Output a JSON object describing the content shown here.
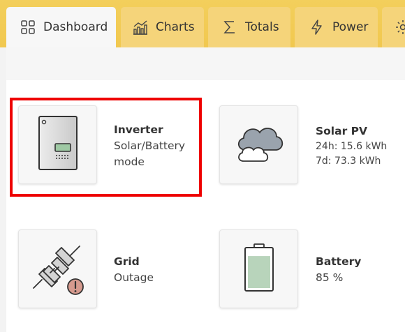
{
  "tabs": [
    {
      "label": "Dashboard",
      "icon": "grid-icon",
      "active": true
    },
    {
      "label": "Charts",
      "icon": "bar-chart-icon",
      "active": false
    },
    {
      "label": "Totals",
      "icon": "sigma-icon",
      "active": false
    },
    {
      "label": "Power",
      "icon": "lightning-icon",
      "active": false
    },
    {
      "label": "",
      "icon": "gear-icon",
      "active": false
    }
  ],
  "cards": {
    "inverter": {
      "title": "Inverter",
      "lines": [
        "Solar/Battery",
        "mode"
      ],
      "icon": "inverter-icon",
      "selected": true
    },
    "solar": {
      "title": "Solar PV",
      "lines": [
        "24h: 15.6 kWh",
        "7d: 73.3 kWh"
      ],
      "icon": "cloud-icon"
    },
    "grid": {
      "title": "Grid",
      "lines": [
        "Outage"
      ],
      "icon": "plug-warning-icon"
    },
    "battery": {
      "title": "Battery",
      "lines": [
        "85 %"
      ],
      "icon": "battery-icon",
      "level": 0.85
    }
  },
  "colors": {
    "header": "#f2c94f",
    "highlight": "#ee0000",
    "battery_fill": "#b8d4bb"
  }
}
